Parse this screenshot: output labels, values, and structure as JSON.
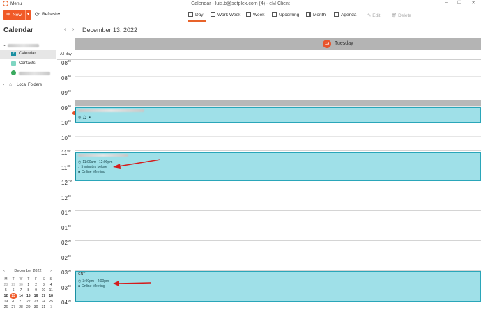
{
  "window": {
    "menu_label": "Menu",
    "title": "Calendar - luis.b@setplex.com (4) - eM Client"
  },
  "toolbar": {
    "new_label": "New",
    "refresh_label": "Refresh",
    "views": [
      {
        "label": "Day"
      },
      {
        "label": "Work Week"
      },
      {
        "label": "Week"
      },
      {
        "label": "Upcoming"
      },
      {
        "label": "Month"
      },
      {
        "label": "Agenda"
      }
    ],
    "edit_label": "Edit",
    "delete_label": "Delete"
  },
  "sidebar": {
    "heading": "Calendar",
    "items": [
      {
        "label": "Calendar",
        "color": "#1b8fa1"
      },
      {
        "label": "Contacts",
        "color": "#7fd6c2"
      },
      {
        "label": "",
        "color": "#3aaa5e"
      }
    ],
    "local_folders_label": "Local Folders"
  },
  "mini_calendar": {
    "title": "December 2022",
    "weekdays": [
      "M",
      "T",
      "W",
      "T",
      "F",
      "S",
      "S"
    ],
    "weeks": [
      [
        "28",
        "29",
        "30",
        "1",
        "2",
        "3",
        "4"
      ],
      [
        "5",
        "6",
        "7",
        "8",
        "9",
        "10",
        "11"
      ],
      [
        "12",
        "13",
        "14",
        "15",
        "16",
        "17",
        "18"
      ],
      [
        "19",
        "20",
        "21",
        "22",
        "23",
        "24",
        "25"
      ],
      [
        "26",
        "27",
        "28",
        "29",
        "30",
        "31",
        "1"
      ]
    ],
    "today": "13"
  },
  "main": {
    "date_title": "December 13, 2022",
    "day_number": "13",
    "day_name": "Tuesday",
    "allday_label": "All-day"
  },
  "time_labels": [
    {
      "h": "08",
      "m": "00"
    },
    {
      "h": "08",
      "m": "30"
    },
    {
      "h": "09",
      "m": "00"
    },
    {
      "h": "09",
      "m": "30"
    },
    {
      "h": "10",
      "m": "00"
    },
    {
      "h": "10",
      "m": "30"
    },
    {
      "h": "11",
      "m": "00"
    },
    {
      "h": "11",
      "m": "30"
    },
    {
      "h": "12",
      "m": "PM"
    },
    {
      "h": "12",
      "m": "30"
    },
    {
      "h": "01",
      "m": "00"
    },
    {
      "h": "01",
      "m": "30"
    },
    {
      "h": "02",
      "m": "00"
    },
    {
      "h": "02",
      "m": "30"
    },
    {
      "h": "03",
      "m": "00"
    },
    {
      "h": "03",
      "m": "30"
    },
    {
      "h": "04",
      "m": "00"
    }
  ],
  "events": {
    "e1": {
      "title": ""
    },
    "e2": {
      "title": "",
      "time": "11:00am - 12:00pm",
      "reminder": "5 minutes before",
      "meeting": "Online Meeting"
    },
    "e3": {
      "title": "CNT",
      "time": "3:00pm - 4:00pm",
      "meeting": "Online Meeting"
    }
  }
}
